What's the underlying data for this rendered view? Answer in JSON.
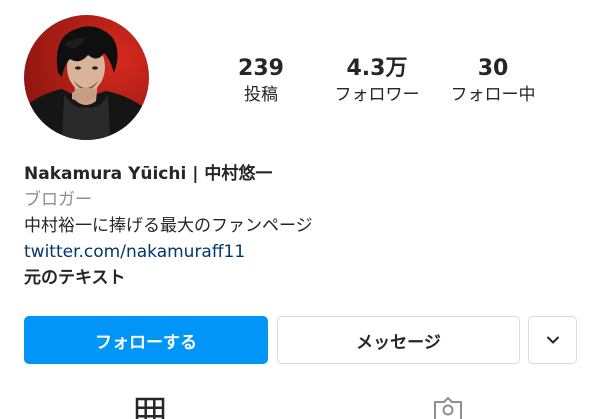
{
  "profile": {
    "name": "Nakamura Yūichi | 中村悠一",
    "category": "ブロガー",
    "description": "中村裕一に捧げる最大のファンページ",
    "link": "twitter.com/nakamuraff11",
    "translate_label": "元のテキスト"
  },
  "stats": {
    "posts": {
      "value": "239",
      "label": "投稿"
    },
    "followers": {
      "value": "4.3万",
      "label": "フォロワー"
    },
    "following": {
      "value": "30",
      "label": "フォロー中"
    }
  },
  "actions": {
    "follow_label": "フォローする",
    "message_label": "メッセージ",
    "more_icon": "chevron-down-icon"
  },
  "tabs": [
    {
      "icon": "grid-icon"
    },
    {
      "icon": "tagged-photos-icon"
    }
  ],
  "colors": {
    "follow_button": "#0095f6",
    "link": "#00376b",
    "category": "#8e8e8e",
    "text": "#262626"
  }
}
